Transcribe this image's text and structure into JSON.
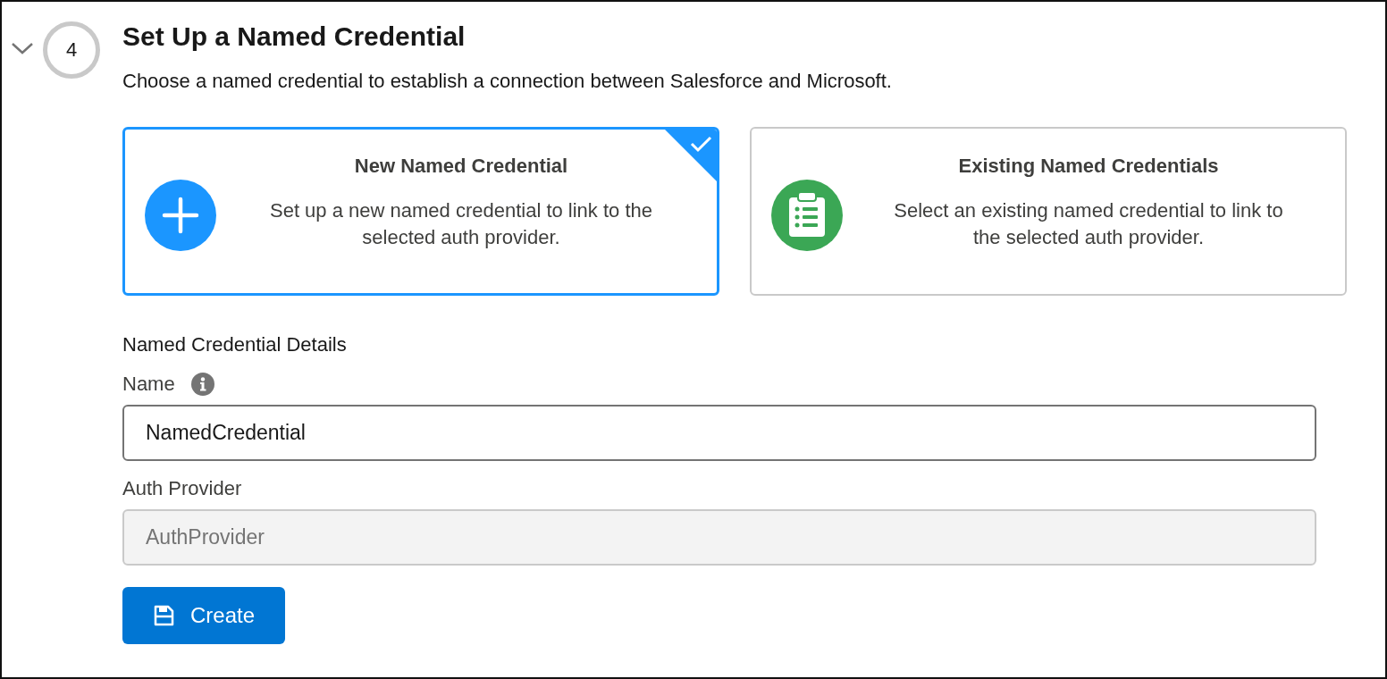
{
  "step": {
    "number": "4",
    "expanded": true,
    "title": "Set Up a Named Credential",
    "description": "Choose a named credential to establish a connection between Salesforce and Microsoft."
  },
  "options": [
    {
      "kind": "new",
      "title": "New Named Credential",
      "description": "Set up a new named credential to link to the selected auth provider.",
      "selected": true
    },
    {
      "kind": "existing",
      "title": "Existing Named Credentials",
      "description": "Select an existing named credential to link to the selected auth provider.",
      "selected": false
    }
  ],
  "details": {
    "heading": "Named Credential Details",
    "fields": [
      {
        "label": "Name",
        "info": true,
        "value": "NamedCredential",
        "disabled": false
      },
      {
        "label": "Auth Provider",
        "info": false,
        "placeholder": "AuthProvider",
        "disabled": true
      }
    ]
  },
  "button": {
    "label": "Create"
  }
}
